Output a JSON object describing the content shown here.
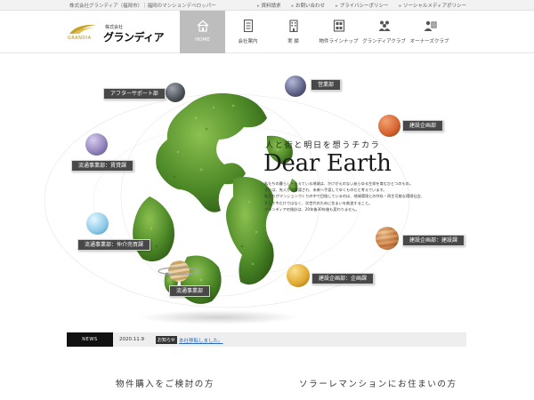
{
  "topbar": {
    "corporate_text": "株式会社グランディア（福岡市）｜福岡のマンションデベロッパー",
    "links": [
      "資料請求",
      "お問い合わせ",
      "プライバシーポリシー",
      "ソーシャルメディアポリシー"
    ]
  },
  "logo": {
    "company_prefix": "株式会社",
    "name_ja": "グランディア",
    "name_en": "GRANDIA",
    "mark_color": "#c9a227"
  },
  "nav": [
    {
      "label": "HOME",
      "icon": "home-icon",
      "active": true
    },
    {
      "label": "会社案内",
      "icon": "document-icon",
      "active": false
    },
    {
      "label": "実 績",
      "icon": "building-icon",
      "active": false
    },
    {
      "label": "物件ラインナップ",
      "icon": "property-list-icon",
      "active": false
    },
    {
      "label": "グランディアクラブ",
      "icon": "people-icon",
      "active": false
    },
    {
      "label": "オーナーズクラブ",
      "icon": "owners-icon",
      "active": false
    }
  ],
  "hero": {
    "departments": [
      {
        "label": "アフターサポート部",
        "planet_color": "#4a4f56"
      },
      {
        "label": "営業部",
        "planet_color": "#5a5f82"
      },
      {
        "label": "建設企画部",
        "planet_color": "#d4622e"
      },
      {
        "label": "流通事業部：賃貸課",
        "planet_color": "#8f7fb8"
      },
      {
        "label": "流通事業部：仲介売買課",
        "planet_color": "#8ac8e8"
      },
      {
        "label": "建設企画部：建設課",
        "planet_color": "#cc7a3a"
      },
      {
        "label": "建設企画部：企画課",
        "planet_color": "#e0a830"
      },
      {
        "label": "流通事業部",
        "planet_color": "#c9a36a"
      }
    ],
    "catch_copy": "人と街と明日を想うチカラ",
    "headline": "Dear Earth",
    "body": [
      "私たちの暮らしを支えている地球は、かけがえのないあらゆる生命を育むひとつのもの。",
      "それは、先人から手渡され、未来へ手渡してゆくものだと考えています。",
      "私たちがマンションづくりの中で目指しているのは、地球環境との共存・再生可能な環境社会、",
      "そして今だけではなく、次世代のために住まいを創造すること。",
      "グランディアの指針は、20年後30年後も変わりません。"
    ]
  },
  "news": {
    "label": "NEWS",
    "date": "2020.11.9",
    "category": "お知らせ",
    "title": "本社移転しました。"
  },
  "bottom": {
    "left": "物件購入をご検討の方",
    "right": "ソラーレマンションにお住まいの方"
  }
}
